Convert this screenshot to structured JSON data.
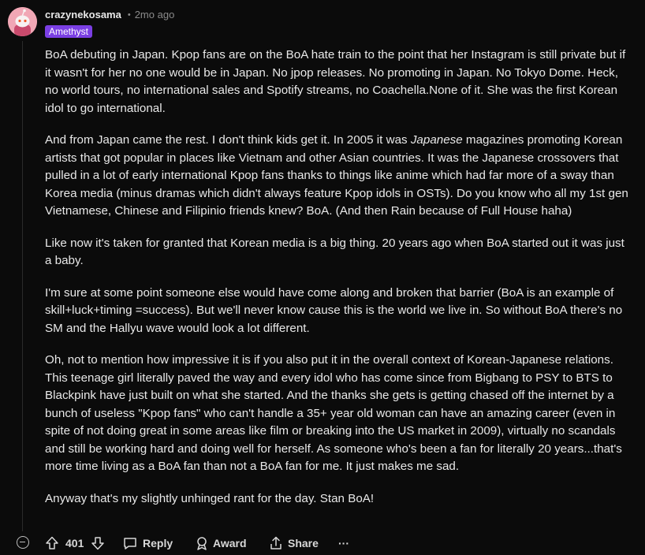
{
  "comment": {
    "username": "crazynekosama",
    "separator": "•",
    "time": "2mo ago",
    "flair": "Amethyst",
    "paragraphs": {
      "p1": "BoA debuting in Japan. Kpop fans are on the BoA hate train to the point that her Instagram is still private but if it wasn't for her no one would be in Japan. No jpop releases. No promoting in Japan. No Tokyo Dome. Heck, no world tours, no international sales and Spotify streams, no Coachella.None of it. She was the first Korean idol to go international.",
      "p2_a": "And from Japan came the rest. I don't think kids get it. In 2005 it was ",
      "p2_em": "Japanese",
      "p2_b": " magazines promoting Korean artists that got popular in places like Vietnam and other Asian countries. It was the Japanese crossovers that pulled in a lot of early international Kpop fans thanks to things like anime which had far more of a sway than Korea media (minus dramas which didn't always feature Kpop idols in OSTs). Do you know who all my 1st gen Vietnamese, Chinese and Filipinio friends knew? BoA. (And then Rain because of Full House haha)",
      "p3": "Like now it's taken for granted that Korean media is a big thing. 20 years ago when BoA started out it was just a baby.",
      "p4": "I'm sure at some point someone else would have come along and broken that barrier (BoA is an example of skill+luck+timing =success). But we'll never know cause this is the world we live in. So without BoA there's no SM and the Hallyu wave would look a lot different.",
      "p5": "Oh, not to mention how impressive it is if you also put it in the overall context of Korean-Japanese relations. This teenage girl literally paved the way and every idol who has come since from Bigbang to PSY to BTS to Blackpink have just built on what she started. And the thanks she gets is getting chased off the internet by a bunch of useless \"Kpop fans\" who can't handle a 35+ year old woman can have an amazing career (even in spite of not doing great in some areas like film or breaking into the US market in 2009), virtually no scandals and still be working hard and doing well for herself. As someone who's been a fan for literally 20 years...that's more time living as a BoA fan than not a BoA fan for me. It just makes me sad.",
      "p6": "Anyway that's my slightly unhinged rant for the day. Stan BoA!"
    }
  },
  "actions": {
    "vote_count": "401",
    "reply_label": "Reply",
    "award_label": "Award",
    "share_label": "Share",
    "more_label": "···"
  },
  "colors": {
    "background": "#0b0b0b",
    "flair_bg": "#7b3fe4",
    "avatar_bg": "#f1a7b5",
    "muted_text": "#8a8a8a"
  },
  "icons": [
    "avatar-icon",
    "collapse-icon",
    "upvote-icon",
    "downvote-icon",
    "reply-icon",
    "award-icon",
    "share-icon",
    "more-icon"
  ]
}
